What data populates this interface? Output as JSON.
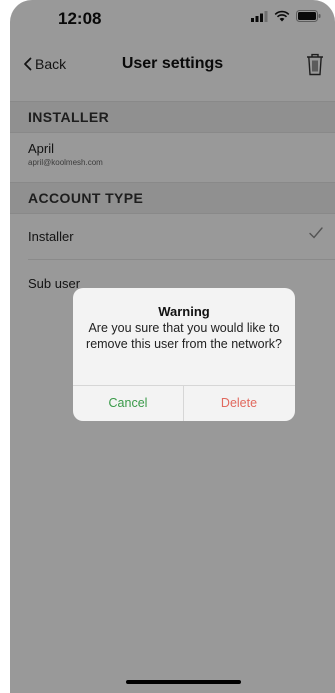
{
  "status_bar": {
    "time": "12:08"
  },
  "nav": {
    "back_label": "Back",
    "title": "User settings"
  },
  "installer_section": {
    "header": "INSTALLER",
    "user_name": "April",
    "user_email": "april@koolmesh.com"
  },
  "account_type_section": {
    "header": "ACCOUNT TYPE",
    "options": [
      {
        "label": "Installer",
        "selected": true
      },
      {
        "label": "Sub user",
        "selected": false
      }
    ]
  },
  "dialog": {
    "title": "Warning",
    "message": "Are you sure that you would like to remove this user from the network?",
    "cancel_label": "Cancel",
    "delete_label": "Delete"
  },
  "colors": {
    "cancel": "#3a9a49",
    "delete": "#e1695e",
    "overlay": "rgba(0,0,0,0.4)"
  }
}
